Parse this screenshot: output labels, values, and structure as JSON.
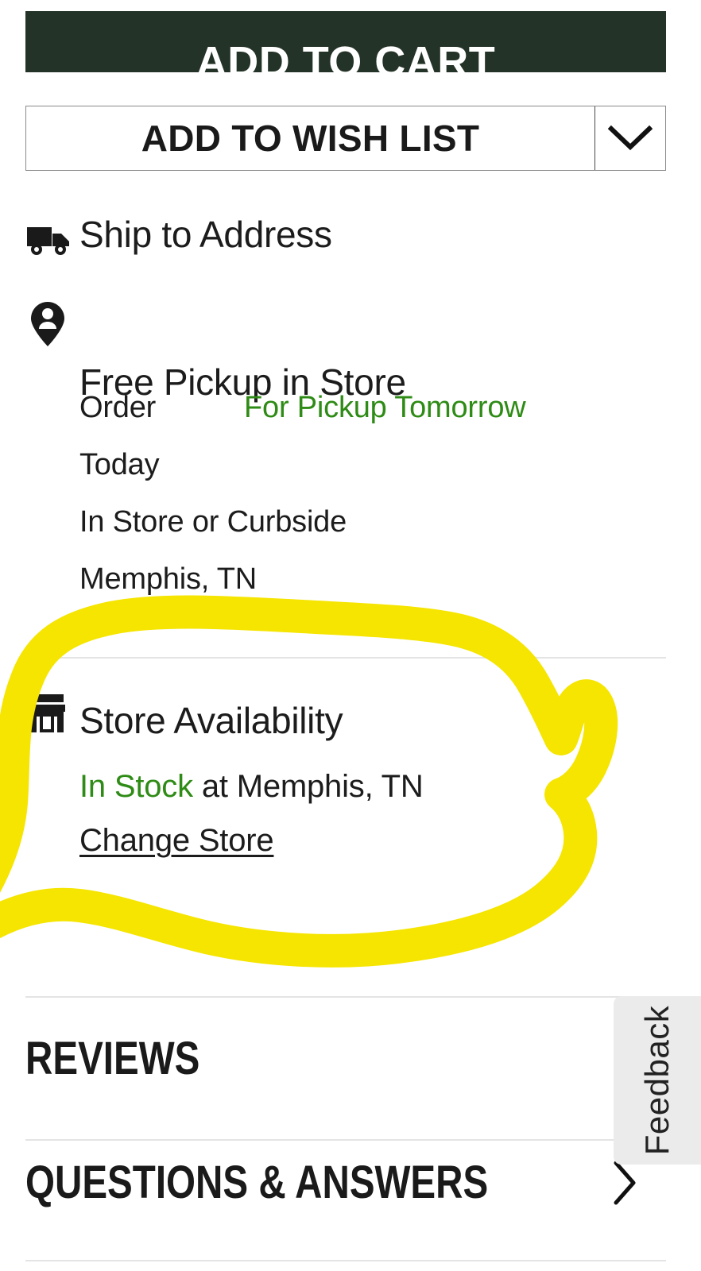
{
  "colors": {
    "cart_button_bg": "#243327",
    "cart_button_text": "#ffffff",
    "in_stock_green": "#2e8b15",
    "pickup_green": "#2e8b15",
    "annotation_yellow": "#f5e500",
    "divider": "#e4e4e4",
    "feedback_tab_bg": "#ebebeb",
    "body_text": "#1c1c1c"
  },
  "actions": {
    "add_to_cart": "ADD TO CART",
    "add_to_wish_list": "ADD TO WISH LIST",
    "wishlist_caret_icon": "chevron-down-icon"
  },
  "fulfillment": {
    "ship": {
      "icon": "truck-icon",
      "label": "Ship to Address"
    },
    "pickup": {
      "icon": "map-pin-person-icon",
      "label": "Free Pickup in Store",
      "order_label": "Order",
      "when_label": "For Pickup Tomorrow",
      "today_label": "Today",
      "mode_label": "In Store or Curbside",
      "city_label": "Memphis, TN"
    }
  },
  "store_availability": {
    "icon": "storefront-icon",
    "title": "Store Availability",
    "stock_status": "In Stock",
    "stock_location": " at Memphis, TN",
    "change_store_link": "Change Store"
  },
  "sections": {
    "reviews": {
      "title": "REVIEWS"
    },
    "questions_answers": {
      "title": "QUESTIONS & ANSWERS",
      "chevron_icon": "chevron-right-icon"
    }
  },
  "feedback": {
    "label": "Feedback"
  },
  "annotation": {
    "type": "hand-drawn-circle",
    "target": "store-availability-section",
    "color": "#f5e500"
  }
}
